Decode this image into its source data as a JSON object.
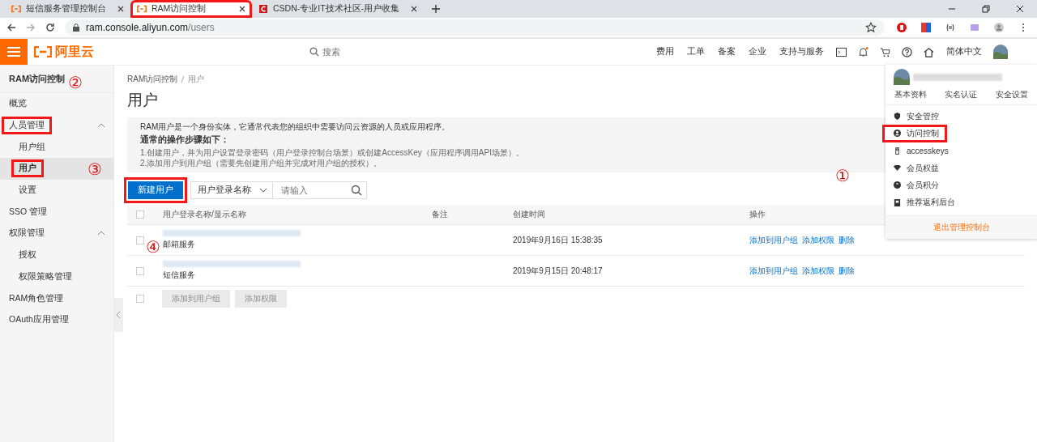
{
  "browser": {
    "tabs": [
      {
        "title": "短信服务管理控制台",
        "selected": false,
        "highlighted": false,
        "kind": "aliyun"
      },
      {
        "title": "RAM访问控制",
        "selected": true,
        "highlighted": true,
        "kind": "aliyun"
      },
      {
        "title": "CSDN-专业IT技术社区-用户收集",
        "selected": false,
        "highlighted": false,
        "kind": "csdn"
      }
    ],
    "url": {
      "host": "ram.console.aliyun.com",
      "path": "/users"
    }
  },
  "topbar": {
    "logo": "阿里云",
    "search": {
      "placeholder": "搜索"
    },
    "links": [
      "费用",
      "工单",
      "备案",
      "企业",
      "支持与服务"
    ],
    "language": "简体中文"
  },
  "sidebar": {
    "title": "RAM访问控制",
    "items": [
      {
        "label": "概览",
        "selected": false,
        "highlighted": false
      },
      {
        "label": "人员管理",
        "selected": false,
        "highlighted": true,
        "expanded": true,
        "children": [
          {
            "label": "用户组",
            "selected": false,
            "highlighted": false
          },
          {
            "label": "用户",
            "selected": true,
            "highlighted": true
          },
          {
            "label": "设置",
            "selected": false,
            "highlighted": false
          }
        ]
      },
      {
        "label": "SSO 管理",
        "selected": false,
        "highlighted": false
      },
      {
        "label": "权限管理",
        "selected": false,
        "highlighted": false,
        "expanded": true,
        "children": [
          {
            "label": "授权",
            "selected": false,
            "highlighted": false
          },
          {
            "label": "权限策略管理",
            "selected": false,
            "highlighted": false
          }
        ]
      },
      {
        "label": "RAM角色管理",
        "selected": false,
        "highlighted": false
      },
      {
        "label": "OAuth应用管理",
        "selected": false,
        "highlighted": false
      }
    ]
  },
  "breadcrumb": [
    "RAM访问控制",
    "用户"
  ],
  "page_title": "用户",
  "info": {
    "text": "RAM用户是一个身份实体，它通常代表您的组织中需要访问云资源的人员或应用程序。",
    "heading": "通常的操作步骤如下：",
    "steps": [
      "1.创建用户，并为用户设置登录密码（用户登录控制台场景）或创建AccessKey（应用程序调用API场景）。",
      "2.添加用户到用户组（需要先创建用户组并完成对用户组的授权）。"
    ]
  },
  "toolbar": {
    "create_button": {
      "label": "新建用户",
      "highlighted": true
    },
    "filter": "用户登录名称",
    "search": {
      "placeholder": "请输入"
    }
  },
  "table": {
    "select_all": {
      "checked": false
    },
    "columns": [
      "用户登录名称/显示名称",
      "备注",
      "创建时间",
      "操作"
    ],
    "rows": [
      {
        "checked": false,
        "display_name": "邮箱服务",
        "created": "2019年9月16日 15:38:35",
        "actions": [
          "添加到用户组",
          "添加权限",
          "删除"
        ]
      },
      {
        "checked": false,
        "display_name": "短信服务",
        "created": "2019年9月15日 20:48:17",
        "actions": [
          "添加到用户组",
          "添加权限",
          "删除"
        ]
      }
    ]
  },
  "bulk": {
    "select": {
      "checked": false
    },
    "buttons": [
      {
        "label": "添加到用户组",
        "disabled": true
      },
      {
        "label": "添加权限",
        "disabled": true
      }
    ]
  },
  "user_menu": {
    "tabs": [
      "基本资料",
      "实名认证",
      "安全设置"
    ],
    "items": [
      {
        "label": "安全管控",
        "kind": "shield",
        "highlighted": false
      },
      {
        "label": "访问控制",
        "kind": "user",
        "highlighted": true
      },
      {
        "label": "accesskeys",
        "kind": "key",
        "highlighted": false
      },
      {
        "label": "会员权益",
        "kind": "diamond",
        "highlighted": false
      },
      {
        "label": "会员积分",
        "kind": "coin",
        "highlighted": false
      },
      {
        "label": "推荐返利后台",
        "kind": "book",
        "highlighted": false
      }
    ],
    "logout": "退出管理控制台"
  },
  "annotations": [
    "②",
    "③",
    "①",
    "④"
  ]
}
